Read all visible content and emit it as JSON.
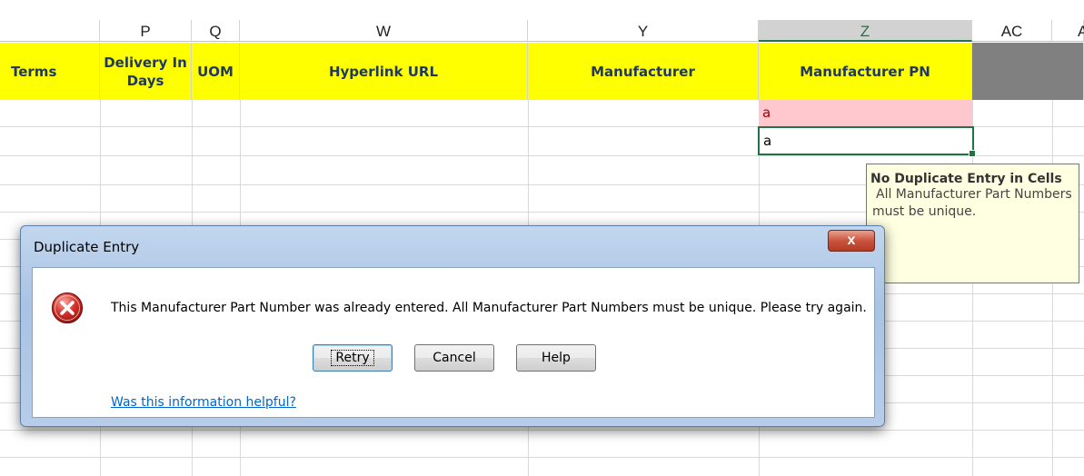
{
  "columns": [
    {
      "letter": "P"
    },
    {
      "letter": "Q"
    },
    {
      "letter": "W"
    },
    {
      "letter": "Y"
    },
    {
      "letter": "Z"
    },
    {
      "letter": "AC"
    },
    {
      "letter": "A"
    }
  ],
  "header_row": {
    "terms": "Terms",
    "delivery_line1": "Delivery In",
    "delivery_line2": "Days",
    "uom": "UOM",
    "hyperlink": "Hyperlink URL",
    "manufacturer": "Manufacturer",
    "manufacturer_pn": "Manufacturer PN"
  },
  "cells": {
    "duplicate_value": "a",
    "active_value": "a"
  },
  "tooltip": {
    "title": "No Duplicate Entry in Cells",
    "body_line1": "All Manufacturer Part Numbers",
    "body_line2": "must be unique."
  },
  "dialog": {
    "title": "Duplicate Entry",
    "close_label": "x",
    "icon": "error-icon",
    "message": "This Manufacturer Part Number was already entered.  All Manufacturer Part Numbers must be unique.  Please try again.",
    "buttons": {
      "retry": "Retry",
      "cancel": "Cancel",
      "help": "Help"
    },
    "link": "Was this information helpful?"
  },
  "colors": {
    "header_fill": "#ffff00",
    "duplicate_fill": "#ffc7ce",
    "duplicate_text": "#9c0006",
    "selection": "#217346",
    "link": "#0066cc"
  }
}
